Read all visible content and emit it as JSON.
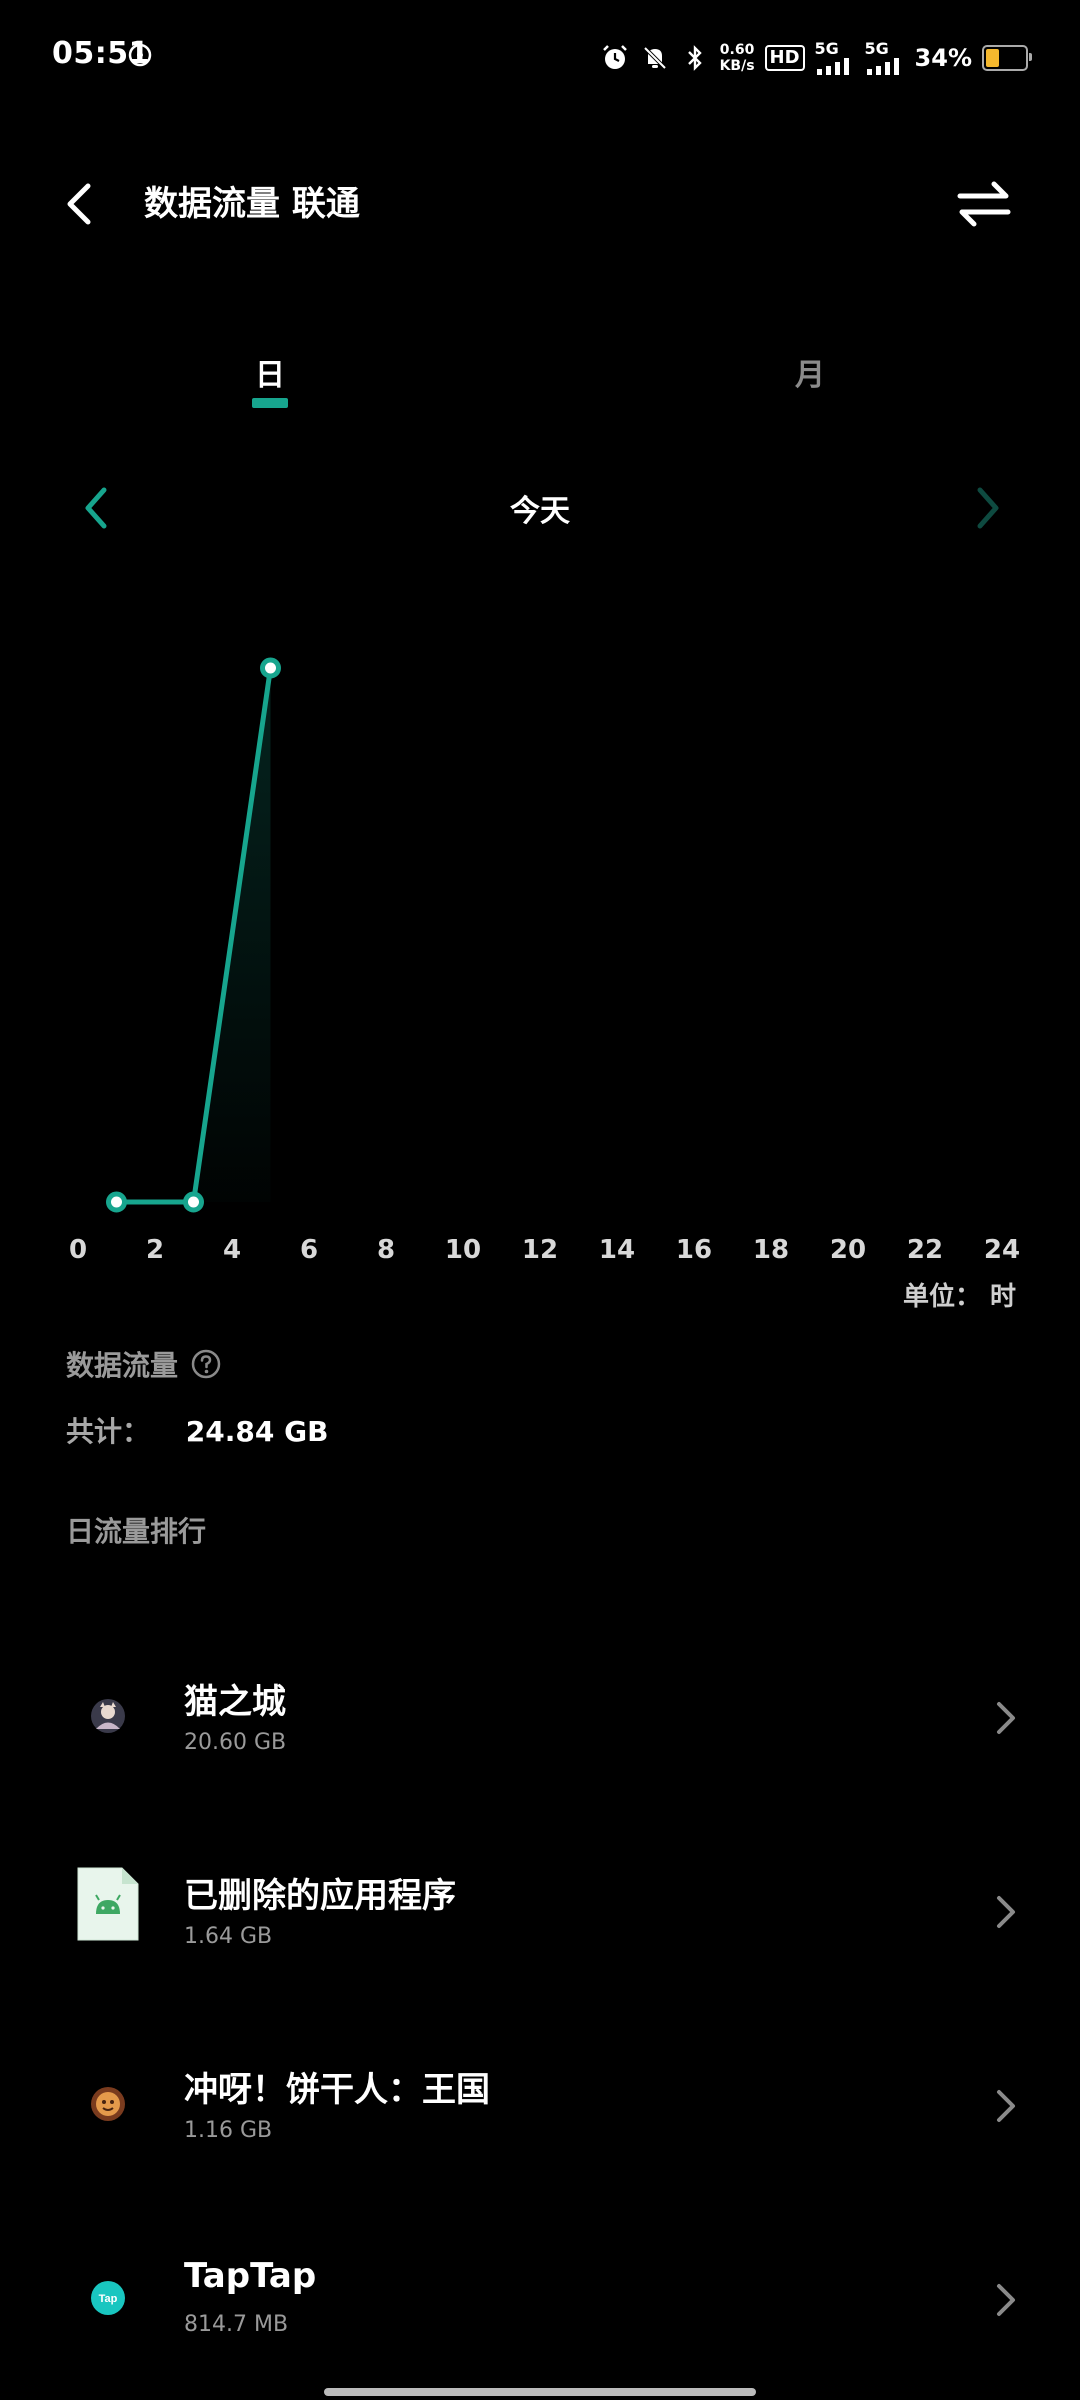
{
  "status_bar": {
    "time": "05:51",
    "net_speed_value": "0.60",
    "net_speed_unit": "KB/s",
    "hd_label": "HD",
    "signal_label_1": "5G",
    "signal_label_2": "5G",
    "battery_percent_text": "34%",
    "battery_level": 0.34,
    "battery_color": "#f5b82e"
  },
  "header": {
    "title": "数据流量  联通"
  },
  "tabs": [
    {
      "label": "日",
      "active": true
    },
    {
      "label": "月",
      "active": false
    }
  ],
  "date_nav": {
    "label": "今天"
  },
  "chart_data": {
    "type": "line",
    "x": [
      1,
      3,
      5
    ],
    "values": [
      0,
      0,
      1
    ],
    "xlim": [
      0,
      24
    ],
    "ylim": [
      0,
      1
    ],
    "x_ticks": [
      "0",
      "2",
      "4",
      "6",
      "8",
      "10",
      "12",
      "14",
      "16",
      "18",
      "20",
      "22",
      "24"
    ],
    "xlabel": "单位：  时",
    "grid": false,
    "line_color": "#17a58e"
  },
  "summary": {
    "section_label": "数据流量",
    "total_label": "共计：",
    "total_value": "24.84 GB",
    "ranking_label": "日流量排行"
  },
  "apps": [
    {
      "name": "猫之城",
      "size": "20.60 GB",
      "icon": "cat-city-app-icon"
    },
    {
      "name": "已删除的应用程序",
      "size": "1.64 GB",
      "icon": "android-app-icon"
    },
    {
      "name": "冲呀！饼干人：王国",
      "size": "1.16 GB",
      "icon": "cookie-run-app-icon"
    },
    {
      "name": "TapTap",
      "size": "814.7 MB",
      "icon": "taptap-app-icon",
      "icon_text": "Tap"
    }
  ],
  "colors": {
    "accent": "#17a58e",
    "background": "#000000"
  }
}
